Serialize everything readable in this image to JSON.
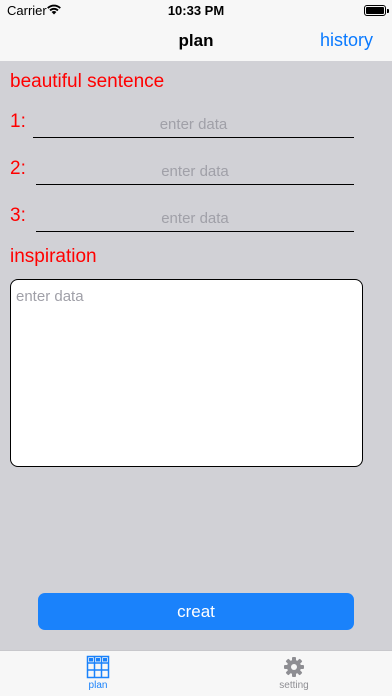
{
  "status_bar": {
    "carrier": "Carrier",
    "time": "10:33 PM"
  },
  "nav": {
    "title": "plan",
    "history_label": "history"
  },
  "form": {
    "sentence_heading": "beautiful sentence",
    "sentences": [
      {
        "number": "1:",
        "placeholder": "enter data",
        "value": ""
      },
      {
        "number": "2:",
        "placeholder": "enter data",
        "value": ""
      },
      {
        "number": "3:",
        "placeholder": "enter data",
        "value": ""
      }
    ],
    "inspiration_heading": "inspiration",
    "inspiration_placeholder": "enter data",
    "inspiration_value": ""
  },
  "create_button_label": "creat",
  "tabs": [
    {
      "label": "plan",
      "icon": "grid-icon",
      "selected": true
    },
    {
      "label": "setting",
      "icon": "gear-icon",
      "selected": false
    }
  ],
  "colors": {
    "accent": "#1a82fb",
    "label_red": "#ff0000",
    "background": "#d1d1d6",
    "inactive_tab": "#8e8e93"
  }
}
